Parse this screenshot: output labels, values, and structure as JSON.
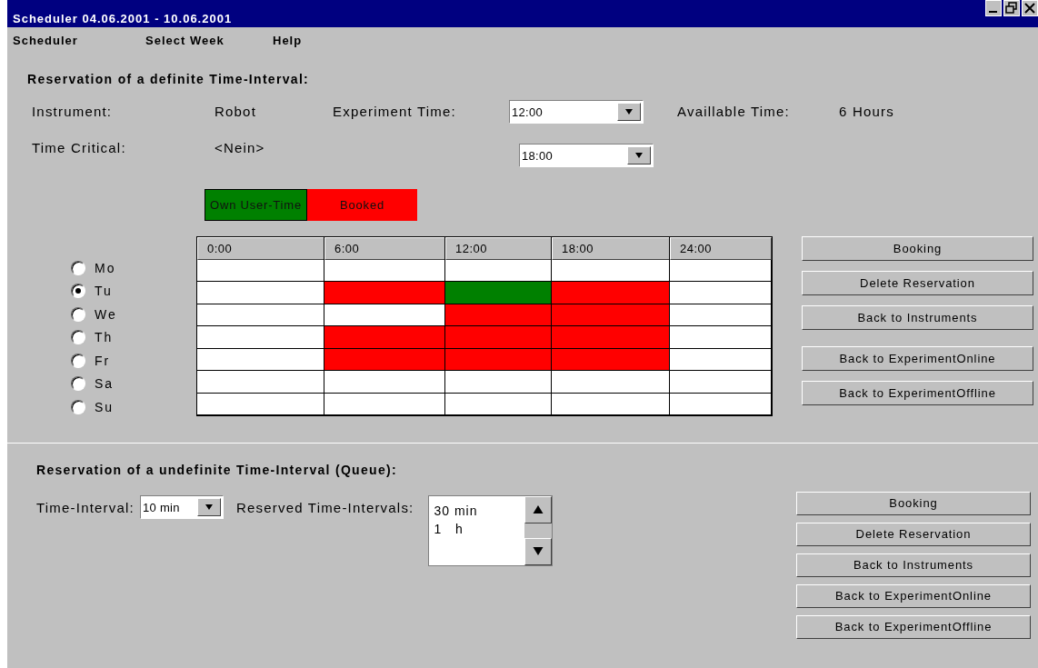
{
  "window": {
    "title": "Scheduler 04.06.2001 - 10.06.2001"
  },
  "menu": [
    "Scheduler",
    "Select Week",
    "Help"
  ],
  "definite": {
    "heading": "Reservation of a definite Time-Interval:",
    "instrument": {
      "label": "Instrument:",
      "value": "Robot"
    },
    "experiment_time": {
      "label": "Experiment Time:",
      "start": "12:00",
      "end": "18:00"
    },
    "available_time": {
      "label": "Availlable Time:",
      "value": "6 Hours"
    },
    "time_critical": {
      "label": "Time Critical:",
      "value": "<Nein>"
    },
    "legend": [
      {
        "label": "Own User-Time",
        "kind": "own"
      },
      {
        "label": "Booked",
        "kind": "booked"
      }
    ],
    "schedule": {
      "columns": [
        "0:00",
        "6:00",
        "12:00",
        "18:00",
        "24:00"
      ],
      "days": [
        {
          "label": "Mo",
          "selected": false,
          "cells": [
            {
              "kind": "free"
            },
            {
              "kind": "free"
            },
            {
              "kind": "free"
            },
            {
              "kind": "free"
            },
            {
              "kind": "free"
            }
          ]
        },
        {
          "label": "Tu",
          "selected": true,
          "cells": [
            {
              "kind": "free"
            },
            {
              "kind": "booked"
            },
            {
              "kind": "own"
            },
            {
              "kind": "booked"
            },
            {
              "kind": "free"
            }
          ]
        },
        {
          "label": "We",
          "selected": false,
          "cells": [
            {
              "kind": "free"
            },
            {
              "kind": "free"
            },
            {
              "kind": "booked"
            },
            {
              "kind": "booked"
            },
            {
              "kind": "free"
            }
          ]
        },
        {
          "label": "Th",
          "selected": false,
          "cells": [
            {
              "kind": "free"
            },
            {
              "kind": "booked"
            },
            {
              "kind": "booked"
            },
            {
              "kind": "booked"
            },
            {
              "kind": "free"
            }
          ]
        },
        {
          "label": "Fr",
          "selected": false,
          "cells": [
            {
              "kind": "free"
            },
            {
              "kind": "booked"
            },
            {
              "kind": "booked"
            },
            {
              "kind": "booked"
            },
            {
              "kind": "free"
            }
          ]
        },
        {
          "label": "Sa",
          "selected": false,
          "cells": [
            {
              "kind": "free"
            },
            {
              "kind": "free"
            },
            {
              "kind": "free"
            },
            {
              "kind": "free"
            },
            {
              "kind": "free"
            }
          ]
        },
        {
          "label": "Su",
          "selected": false,
          "cells": [
            {
              "kind": "free"
            },
            {
              "kind": "free"
            },
            {
              "kind": "free"
            },
            {
              "kind": "free"
            },
            {
              "kind": "free"
            }
          ]
        }
      ]
    },
    "buttons": [
      "Booking",
      "Delete Reservation",
      "Back to Instruments",
      "Back to ExperimentOnline",
      "Back to ExperimentOffline"
    ]
  },
  "queue": {
    "heading": "Reservation of a undefinite Time-Interval (Queue):",
    "time_interval": {
      "label": "Time-Interval:",
      "value": "10 min"
    },
    "reserved": {
      "label": "Reserved Time-Intervals:",
      "items": [
        "30 min",
        "1   h"
      ]
    },
    "buttons": [
      "Booking",
      "Delete Reservation",
      "Back to Instruments",
      "Back to ExperimentOnline",
      "Back to ExperimentOffline"
    ]
  }
}
